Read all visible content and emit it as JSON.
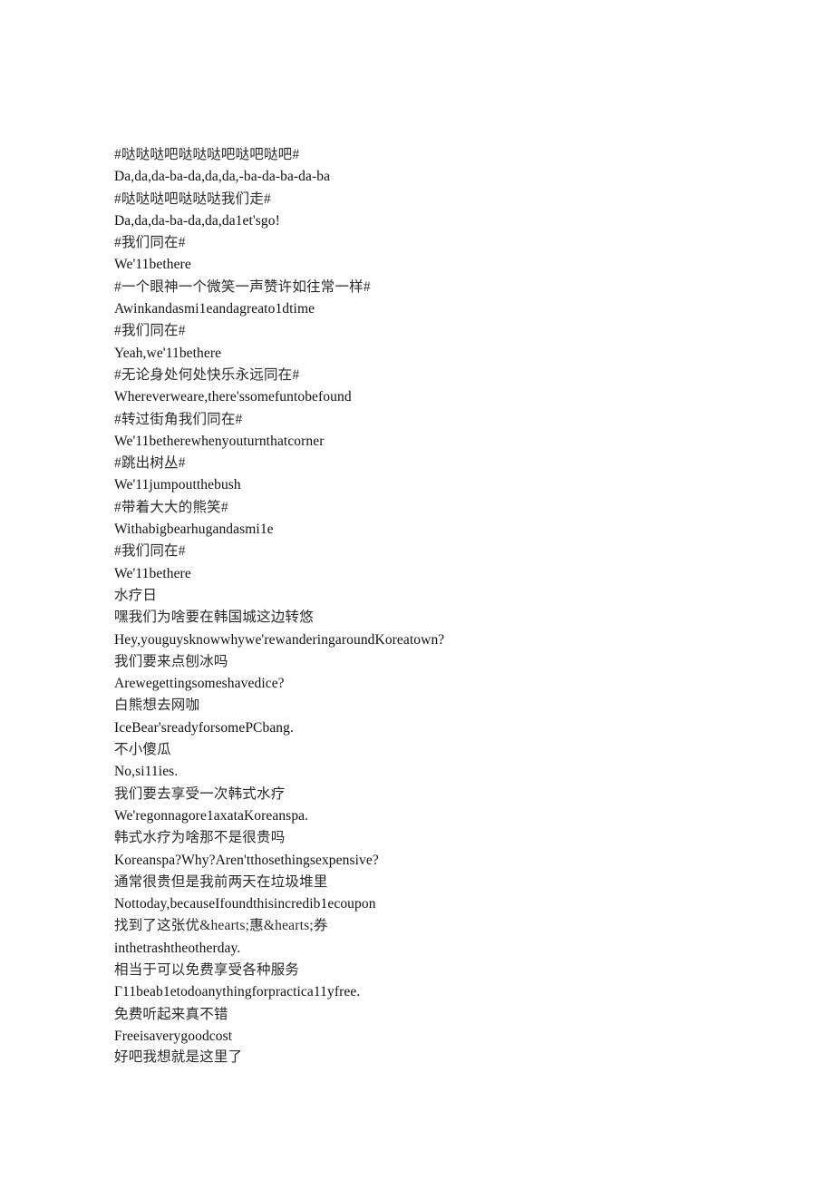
{
  "document": {
    "type": "bilingual-subtitle-transcript",
    "background_color": "#ffffff",
    "text_color": "#1c1c1c",
    "lines": [
      {
        "lang": "zh",
        "text": "#哒哒哒吧哒哒哒吧哒吧哒吧#"
      },
      {
        "lang": "en",
        "text": "Da,da,da-ba-da,da,da,-ba-da-ba-da-ba"
      },
      {
        "lang": "zh",
        "text": "#哒哒哒吧哒哒哒我们走#"
      },
      {
        "lang": "en",
        "text": "Da,da,da-ba-da,da,da1et'sgo!"
      },
      {
        "lang": "zh",
        "text": "#我们同在#"
      },
      {
        "lang": "en",
        "text": "We'11bethere"
      },
      {
        "lang": "zh",
        "text": "#一个眼神一个微笑一声赞许如往常一样#"
      },
      {
        "lang": "en",
        "text": "Awinkandasmi1eandagreato1dtime"
      },
      {
        "lang": "zh",
        "text": "#我们同在#"
      },
      {
        "lang": "en",
        "text": "Yeah,we'11bethere"
      },
      {
        "lang": "zh",
        "text": "#无论身处何处快乐永远同在#"
      },
      {
        "lang": "en",
        "text": "Whereverweare,there'ssomefuntobefound"
      },
      {
        "lang": "zh",
        "text": "#转过街角我们同在#"
      },
      {
        "lang": "en",
        "text": "We'11betherewhenyouturnthatcorner"
      },
      {
        "lang": "zh",
        "text": "#跳出树丛#"
      },
      {
        "lang": "en",
        "text": "We'11jumpoutthebush"
      },
      {
        "lang": "zh",
        "text": "#带着大大的熊笑#"
      },
      {
        "lang": "en",
        "text": "Withabigbearhugandasmi1e"
      },
      {
        "lang": "zh",
        "text": "#我们同在#"
      },
      {
        "lang": "en",
        "text": "We'11bethere"
      },
      {
        "lang": "zh",
        "text": "水疗日"
      },
      {
        "lang": "zh",
        "text": "嘿我们为啥要在韩国城这边转悠"
      },
      {
        "lang": "en",
        "text": "Hey,youguysknowwhywe'rewanderingaroundKoreatown?"
      },
      {
        "lang": "zh",
        "text": "我们要来点刨冰吗"
      },
      {
        "lang": "en",
        "text": "Arewegettingsomeshavedice?"
      },
      {
        "lang": "zh",
        "text": "白熊想去网咖"
      },
      {
        "lang": "en",
        "text": "IceBear'sreadyforsomePCbang."
      },
      {
        "lang": "zh",
        "text": "不小傻瓜"
      },
      {
        "lang": "en",
        "text": "No,si11ies."
      },
      {
        "lang": "zh",
        "text": "我们要去享受一次韩式水疗"
      },
      {
        "lang": "en",
        "text": "We'regonnagore1axataKoreanspa."
      },
      {
        "lang": "zh",
        "text": "韩式水疗为啥那不是很贵吗"
      },
      {
        "lang": "en",
        "text": "Koreanspa?Why?Aren'tthosethingsexpensive?"
      },
      {
        "lang": "zh",
        "text": "通常很贵但是我前两天在垃圾堆里"
      },
      {
        "lang": "en",
        "text": "Nottoday,becauseIfoundthisincredib1ecoupon"
      },
      {
        "lang": "zh",
        "text": "找到了这张优&hearts;惠&hearts;券"
      },
      {
        "lang": "en",
        "text": "inthetrashtheotherday."
      },
      {
        "lang": "zh",
        "text": "相当于可以免费享受各种服务"
      },
      {
        "lang": "en",
        "text": "Γ11beab1etodoanythingforpractica11yfree."
      },
      {
        "lang": "zh",
        "text": "免费听起来真不错"
      },
      {
        "lang": "en",
        "text": "Freeisaverygoodcost"
      },
      {
        "lang": "zh",
        "text": "好吧我想就是这里了"
      }
    ]
  }
}
